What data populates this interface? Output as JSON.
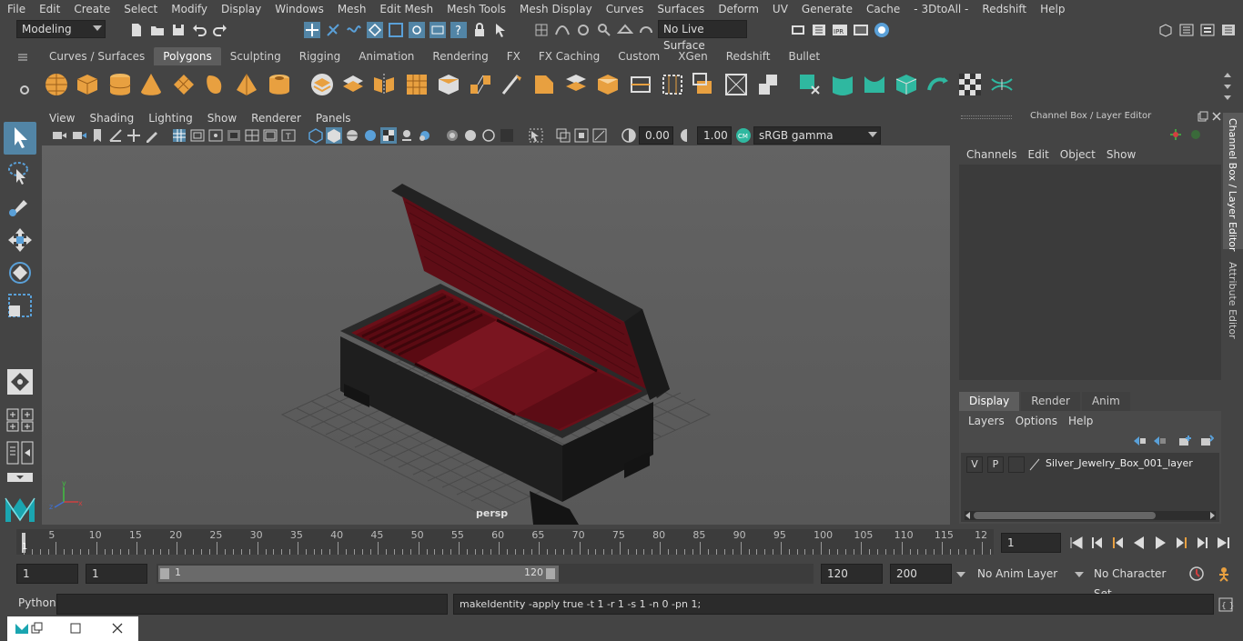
{
  "menu_bar": {
    "items": [
      "File",
      "Edit",
      "Create",
      "Select",
      "Modify",
      "Display",
      "Windows",
      "Mesh",
      "Edit Mesh",
      "Mesh Tools",
      "Mesh Display",
      "Curves",
      "Surfaces",
      "Deform",
      "UV",
      "Generate",
      "Cache",
      "- 3DtoAll -",
      "Redshift",
      "Help"
    ]
  },
  "status_line": {
    "mode": "Modeling",
    "live_surface": "No Live Surface"
  },
  "shelf": {
    "tabs": [
      "Curves / Surfaces",
      "Polygons",
      "Sculpting",
      "Rigging",
      "Animation",
      "Rendering",
      "FX",
      "FX Caching",
      "Custom",
      "XGen",
      "Redshift",
      "Bullet"
    ],
    "active_tab": "Polygons"
  },
  "viewport": {
    "menu": [
      "View",
      "Shading",
      "Lighting",
      "Show",
      "Renderer",
      "Panels"
    ],
    "exposure": "0.00",
    "gamma": "1.00",
    "color_space": "sRGB gamma",
    "camera_label": "persp"
  },
  "channel_box": {
    "title": "Channel Box / Layer Editor",
    "menu": [
      "Channels",
      "Edit",
      "Object",
      "Show"
    ]
  },
  "layer_editor": {
    "tabs": [
      "Display",
      "Render",
      "Anim"
    ],
    "active_tab": "Display",
    "menu": [
      "Layers",
      "Options",
      "Help"
    ],
    "layers": [
      {
        "v": "V",
        "p": "P",
        "name": "Silver_Jewelry_Box_001_layer"
      }
    ]
  },
  "side_tabs": [
    "Channel Box / Layer Editor",
    "Attribute Editor"
  ],
  "timeline": {
    "ticks": [
      "5",
      "10",
      "15",
      "20",
      "25",
      "30",
      "35",
      "40",
      "45",
      "50",
      "55",
      "60",
      "65",
      "70",
      "75",
      "80",
      "85",
      "90",
      "95",
      "100",
      "105",
      "110",
      "115",
      "12"
    ],
    "start_marker": "1",
    "current_frame": "1"
  },
  "range_slider": {
    "start": "1",
    "playback_start": "1",
    "slider_start": "1",
    "slider_end": "120",
    "playback_end": "120",
    "end": "200",
    "anim_layer": "No Anim Layer",
    "character_set": "No Character Set"
  },
  "command_line": {
    "language": "Python",
    "result": "makeIdentity -apply true -t 1 -r 1 -s 1 -n 0 -pn 1;"
  },
  "colors": {
    "maya_bg": "#444444",
    "viewport_bg": "#5f5f5f",
    "shelf_orange": "#e8a040",
    "shelf_teal": "#2fb8a0",
    "accent_blue": "#5aa0d8"
  }
}
